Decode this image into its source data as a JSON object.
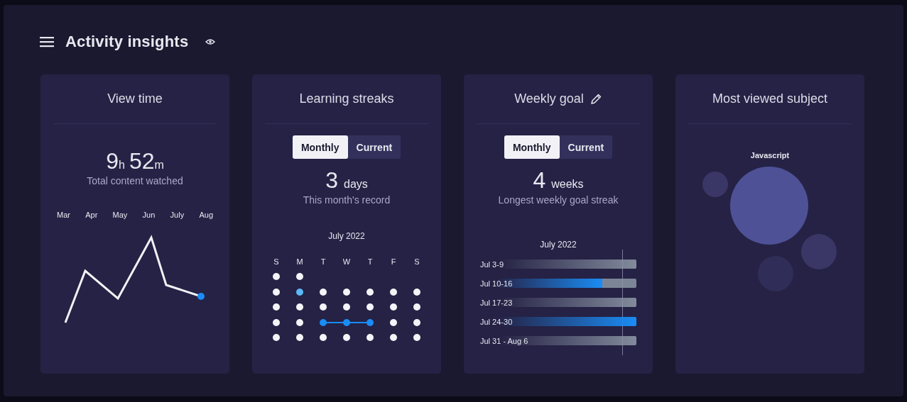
{
  "header": {
    "title": "Activity insights"
  },
  "view_time": {
    "title": "View time",
    "hours": "9",
    "hours_unit": "h",
    "minutes": "52",
    "minutes_unit": "m",
    "caption": "Total content watched",
    "months": [
      "Mar",
      "Apr",
      "May",
      "Jun",
      "July",
      "Aug"
    ]
  },
  "learning_streaks": {
    "title": "Learning streaks",
    "tabs": [
      {
        "label": "Monthly",
        "selected": true
      },
      {
        "label": "Current",
        "selected": false
      }
    ],
    "value": "3",
    "unit": "days",
    "caption": "This month's record",
    "month": "July 2022",
    "weekdays": [
      "S",
      "M",
      "T",
      "W",
      "T",
      "F",
      "S"
    ],
    "weeks": [
      [
        {
          "today": false,
          "streak": false
        },
        {
          "today": false,
          "streak": false
        }
      ],
      [
        {
          "today": false,
          "streak": false
        },
        {
          "today": true,
          "streak": false
        },
        {
          "today": false,
          "streak": false
        },
        {
          "today": false,
          "streak": false
        },
        {
          "today": false,
          "streak": false
        },
        {
          "today": false,
          "streak": false
        },
        {
          "today": false,
          "streak": false
        }
      ],
      [
        {
          "today": false,
          "streak": false
        },
        {
          "today": false,
          "streak": false
        },
        {
          "today": false,
          "streak": false
        },
        {
          "today": false,
          "streak": false
        },
        {
          "today": false,
          "streak": false
        },
        {
          "today": false,
          "streak": false
        },
        {
          "today": false,
          "streak": false
        }
      ],
      [
        {
          "today": false,
          "streak": false
        },
        {
          "today": false,
          "streak": false
        },
        {
          "today": false,
          "streak": true
        },
        {
          "today": false,
          "streak": true
        },
        {
          "today": false,
          "streak": true
        },
        {
          "today": false,
          "streak": false
        },
        {
          "today": false,
          "streak": false
        }
      ],
      [
        {
          "today": false,
          "streak": false
        },
        {
          "today": false,
          "streak": false
        },
        {
          "today": false,
          "streak": false
        },
        {
          "today": false,
          "streak": false
        },
        {
          "today": false,
          "streak": false
        },
        {
          "today": false,
          "streak": false
        },
        {
          "today": false,
          "streak": false
        }
      ]
    ]
  },
  "weekly_goal": {
    "title": "Weekly goal",
    "tabs": [
      {
        "label": "Monthly",
        "selected": true
      },
      {
        "label": "Current",
        "selected": false
      }
    ],
    "value": "4",
    "unit": "weeks",
    "caption": "Longest weekly goal streak",
    "month": "July 2022",
    "weeks": [
      {
        "label": "Jul 3-9",
        "kind": "missed"
      },
      {
        "label": "Jul 10-16",
        "kind": "partial"
      },
      {
        "label": "Jul 17-23",
        "kind": "missed"
      },
      {
        "label": "Jul 24-30",
        "kind": "met"
      },
      {
        "label": "Jul 31 - Aug 6",
        "kind": "missed"
      }
    ]
  },
  "most_viewed": {
    "title": "Most viewed subject",
    "subject": "Javascript"
  }
}
